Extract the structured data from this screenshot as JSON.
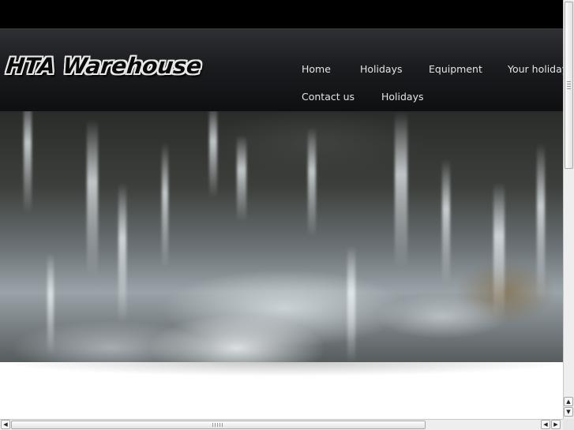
{
  "site": {
    "logo_text": "HTA Warehouse"
  },
  "nav": {
    "items": [
      {
        "label": "Home"
      },
      {
        "label": "Holidays"
      },
      {
        "label": "Equipment"
      },
      {
        "label": "Your holiday"
      },
      {
        "label": "Contact us"
      },
      {
        "label": "Holidays"
      }
    ]
  },
  "hero": {
    "image": "waterfall-photo"
  },
  "scrollbars": {
    "up_arrow": "▲",
    "down_arrow": "▼",
    "left_arrow": "◀",
    "right_arrow": "▶"
  },
  "colors": {
    "topbar": "#000000",
    "header": "#1b1c1f",
    "nav_text": "#e4e4e4",
    "background": "#ffffff"
  }
}
